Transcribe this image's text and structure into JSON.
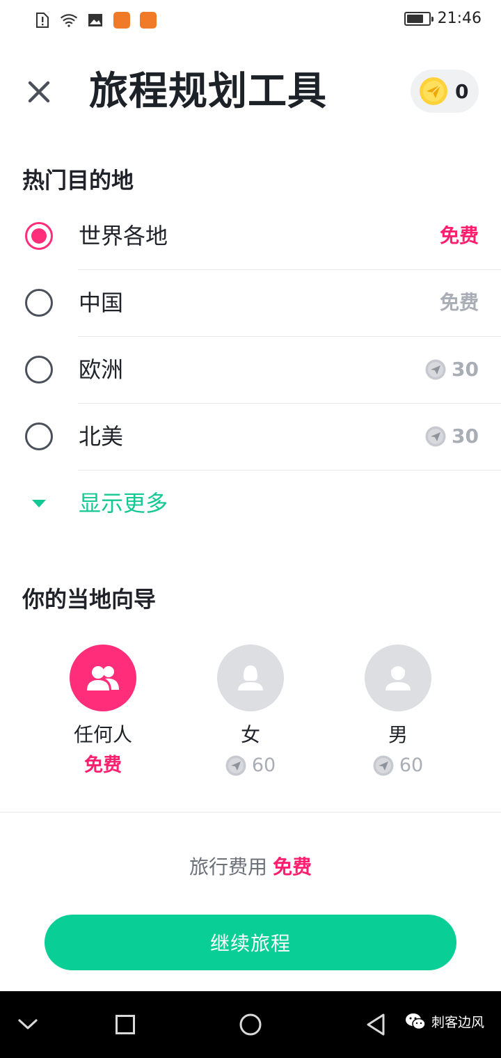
{
  "status_bar": {
    "time": "21:46",
    "icons": [
      "alert-icon",
      "wifi-icon",
      "image-icon",
      "app-icon",
      "app-icon",
      "battery-icon"
    ],
    "battery_level": 0.75
  },
  "header": {
    "title": "旅程规划工具",
    "coins": "0"
  },
  "destinations": {
    "title": "热门目的地",
    "items": [
      {
        "name": "世界各地",
        "price": "免费"
      },
      {
        "name": "中国",
        "price": "免费"
      },
      {
        "name": "欧洲",
        "price": "30"
      },
      {
        "name": "北美",
        "price": "30"
      }
    ],
    "show_more": "显示更多"
  },
  "guides": {
    "title": "你的当地向导",
    "options": [
      {
        "label": "任何人",
        "price": "免费"
      },
      {
        "label": "女",
        "price": "60"
      },
      {
        "label": "男",
        "price": "60"
      }
    ]
  },
  "footer": {
    "cost_label": "旅行费用",
    "cost_value": "免费",
    "continue_label": "继续旅程"
  },
  "watermark": "刺客边风",
  "colors": {
    "accent_pink": "#ff2d7a",
    "accent_green": "#09cf97",
    "muted": "#a9adb5"
  }
}
